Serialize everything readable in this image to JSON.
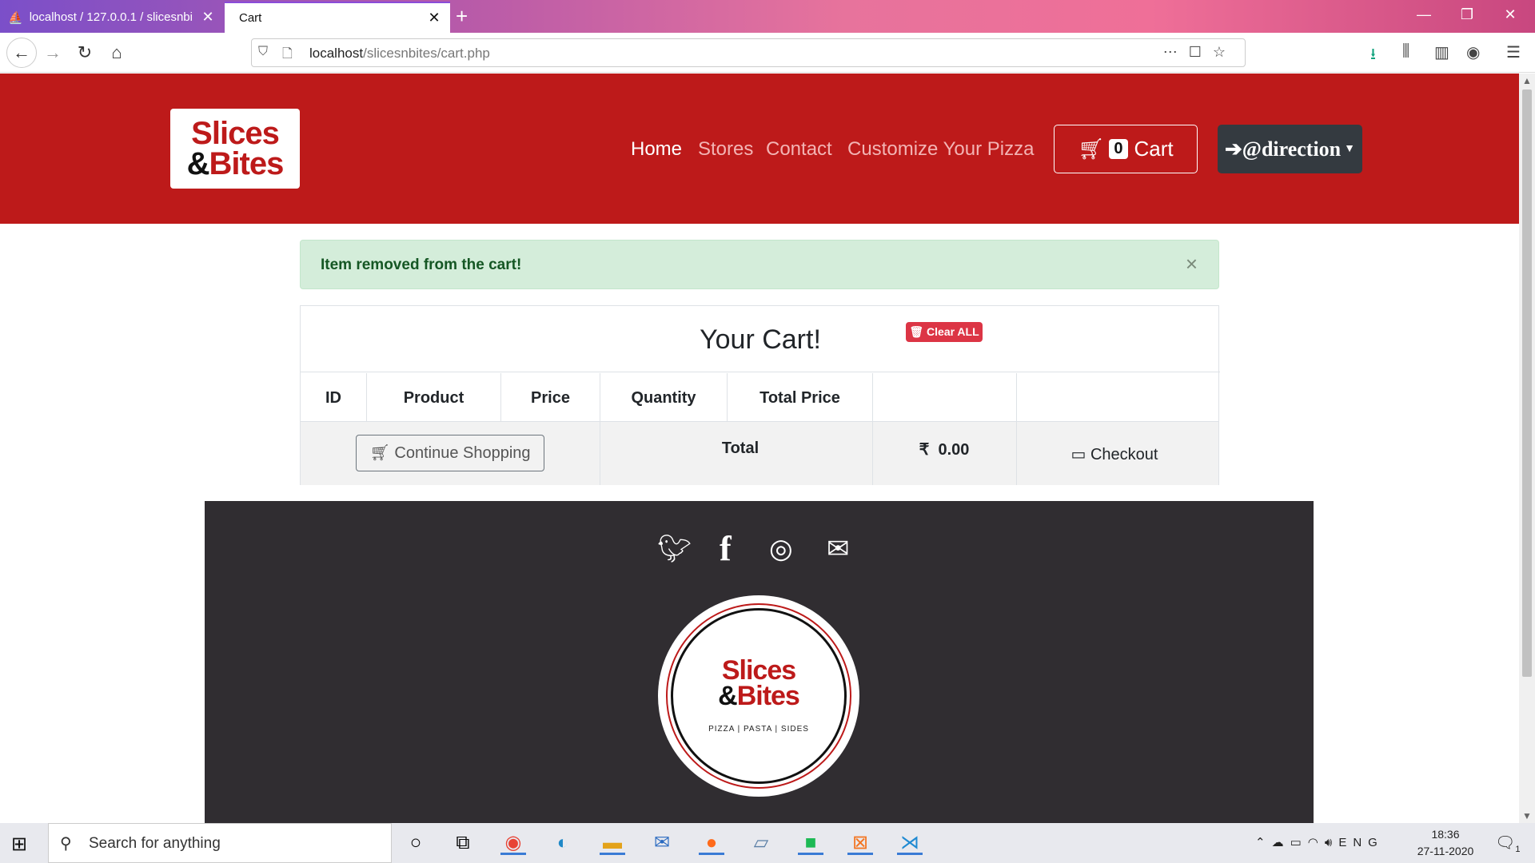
{
  "browser": {
    "tabs": [
      {
        "label": "localhost / 127.0.0.1 / slicesnbi",
        "icon": "phpmyadmin-icon"
      },
      {
        "label": "Cart",
        "icon": "none"
      }
    ],
    "url_host": "localhost",
    "url_path": "/slicesnbites/cart.php"
  },
  "site": {
    "logo_line1": "Slices",
    "logo_amp": "&",
    "logo_line2": "Bites",
    "nav": {
      "home": "Home",
      "stores": "Stores",
      "contact": "Contact",
      "customize": "Customize Your Pizza"
    },
    "cart_count": "0",
    "cart_label": "Cart",
    "user_label": "@direction"
  },
  "alert": {
    "message": "Item removed from the cart!",
    "close": "×"
  },
  "cart": {
    "title": "Your Cart!",
    "columns": [
      "ID",
      "Product",
      "Price",
      "Quantity",
      "Total Price"
    ],
    "clear_all": "Clear ALL",
    "continue_shopping": "Continue Shopping",
    "total_label": "Total",
    "currency": "₹",
    "total_value": "0.00",
    "checkout": "Checkout"
  },
  "footer": {
    "social": [
      "twitter-icon",
      "facebook-icon",
      "instagram-icon",
      "email-icon"
    ],
    "logo_line1": "Slices",
    "logo_amp": "&",
    "logo_line2": "Bites",
    "logo_tagline": "PIZZA | PASTA | SIDES"
  },
  "taskbar": {
    "search_placeholder": "Search for anything",
    "language": "ENG",
    "time": "18:36",
    "date": "27-11-2020",
    "notification_count": "1"
  },
  "colors": {
    "brand_red": "#bd1a1a",
    "footer_bg": "#302d31",
    "alert_bg": "#d4edda",
    "danger": "#dc3545"
  }
}
